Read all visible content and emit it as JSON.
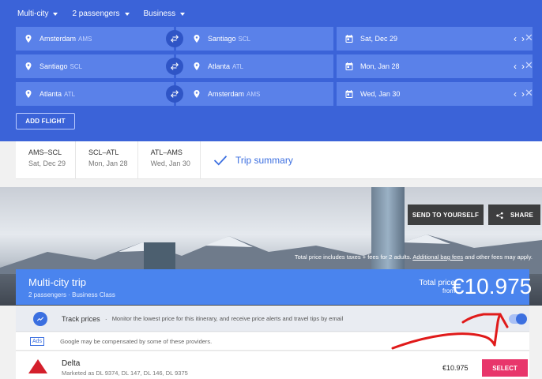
{
  "colors": {
    "header_blue": "#3b63d8",
    "field_blue": "#5a81e9",
    "trip_blue": "#4a84ee",
    "select_pink": "#e8366b",
    "annotation_red": "#e01a1a"
  },
  "topbar": {
    "trip_type": "Multi-city",
    "passengers": "2 passengers",
    "cabin": "Business"
  },
  "legs": [
    {
      "from": "Amsterdam",
      "from_code": "AMS",
      "to": "Santiago",
      "to_code": "SCL",
      "date": "Sat, Dec 29"
    },
    {
      "from": "Santiago",
      "from_code": "SCL",
      "to": "Atlanta",
      "to_code": "ATL",
      "date": "Mon, Jan 28"
    },
    {
      "from": "Atlanta",
      "from_code": "ATL",
      "to": "Amsterdam",
      "to_code": "AMS",
      "date": "Wed, Jan 30"
    }
  ],
  "add_flight": "ADD FLIGHT",
  "tabs": [
    {
      "route": "AMS–SCL",
      "date": "Sat, Dec 29"
    },
    {
      "route": "SCL–ATL",
      "date": "Mon, Jan 28"
    },
    {
      "route": "ATL–AMS",
      "date": "Wed, Jan 30"
    }
  ],
  "trip_summary_label": "Trip summary",
  "hero": {
    "send_btn": "SEND TO YOURSELF",
    "share_btn": "SHARE",
    "note_prefix": "Total price includes taxes + fees for 2 adults.",
    "note_link": "Additional bag fees",
    "note_suffix": "and other fees may apply."
  },
  "trip": {
    "title": "Multi-city trip",
    "subtitle": "2 passengers · Business Class",
    "total_label": "Total price",
    "from_label": "from",
    "amount": "€10.975"
  },
  "track": {
    "label": "Track prices",
    "separator": "·",
    "desc": "Monitor the lowest price for this itinerary, and receive price alerts and travel tips by email",
    "enabled": true
  },
  "ads": {
    "badge": "Ads",
    "text": "Google may be compensated by some of these providers."
  },
  "result": {
    "airline": "Delta",
    "marketed": "Marketed as DL 9374, DL 147, DL 146, DL 9375",
    "price": "€10.975",
    "select": "SELECT"
  }
}
